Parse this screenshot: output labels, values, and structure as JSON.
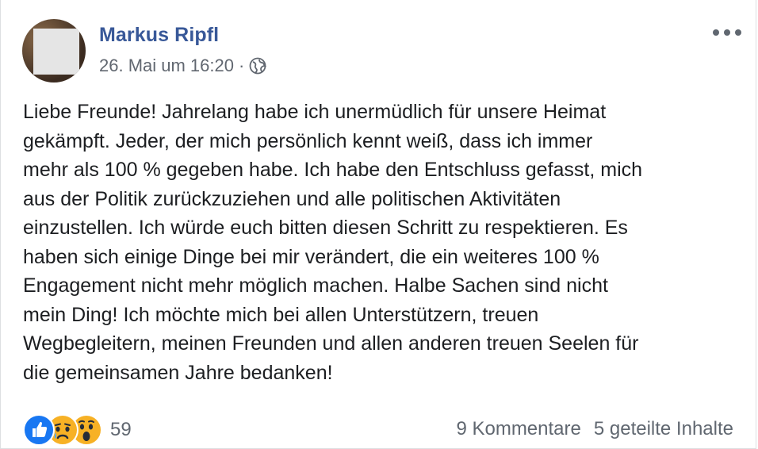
{
  "post": {
    "author": "Markus Ripfl",
    "timestamp": "26. Mai um 16:20",
    "separator": "·",
    "privacy_icon": "globe-icon",
    "more_icon": "more-options-icon",
    "body_lines": [
      "Liebe Freunde! Jahrelang habe ich unermüdlich für unsere Heimat",
      "gekämpft. Jeder, der mich persönlich kennt weiß, dass ich immer",
      "mehr als 100 % gegeben habe. Ich habe den Entschluss gefasst, mich",
      "aus der Politik zurückzuziehen und alle politischen Aktivitäten",
      "einzustellen. Ich würde euch bitten diesen Schritt zu respektieren. Es",
      "haben sich einige Dinge bei mir verändert, die ein weiteres 100 %",
      "Engagement nicht mehr möglich machen. Halbe Sachen sind nicht",
      "mein Ding! Ich möchte mich bei allen Unterstützern, treuen",
      "Wegbegleitern, meinen Freunden und allen anderen treuen Seelen für",
      "die gemeinsamen Jahre bedanken!"
    ]
  },
  "footer": {
    "reaction_icons": [
      "like-icon",
      "sad-icon",
      "wow-icon"
    ],
    "reaction_count": "59",
    "comments": "9 Kommentare",
    "shares": "5 geteilte Inhalte"
  },
  "colors": {
    "author": "#385898",
    "meta": "#616770",
    "text": "#1c1e21",
    "like_blue": "#1877f2",
    "emoji_yellow": "#f7b125"
  }
}
